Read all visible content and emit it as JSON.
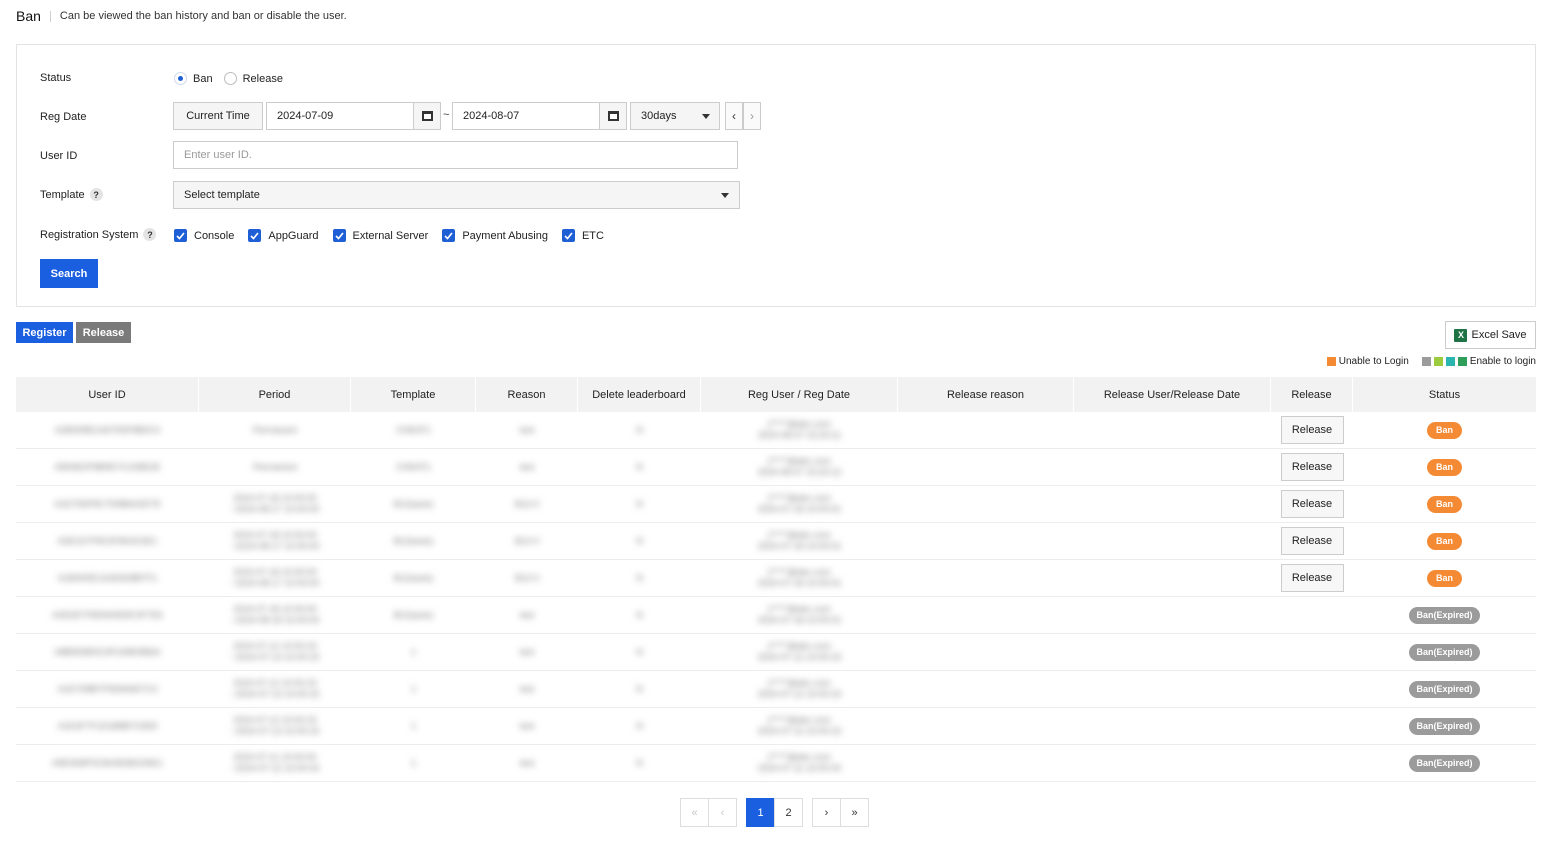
{
  "header": {
    "title": "Ban",
    "description": "Can be viewed the ban history and ban or disable the user."
  },
  "search": {
    "status_label": "Status",
    "status_options": [
      "Ban",
      "Release"
    ],
    "status_selected": "Ban",
    "reg_date_label": "Reg Date",
    "current_time_label": "Current Time",
    "date_from": "2024-07-09",
    "date_to": "2024-08-07",
    "date_separator": "~",
    "range_selected": "30days",
    "user_id_label": "User ID",
    "user_id_placeholder": "Enter user ID.",
    "template_label": "Template",
    "template_placeholder": "Select template",
    "reg_system_label": "Registration System",
    "reg_systems": [
      "Console",
      "AppGuard",
      "External Server",
      "Payment Abusing",
      "ETC"
    ],
    "search_label": "Search",
    "help_glyph": "?"
  },
  "actions": {
    "register_label": "Register",
    "release_label": "Release",
    "excel_label": "Excel Save",
    "excel_glyph": "X"
  },
  "legend": {
    "unable": "Unable to Login",
    "enable": "Enable to login",
    "colors": {
      "unable": "#f58a35",
      "enable": [
        "#9b9b9b",
        "#9ccc3d",
        "#2bb5b0",
        "#2e9e5b"
      ]
    }
  },
  "table": {
    "headers": [
      "User ID",
      "Period",
      "Template",
      "Reason",
      "Delete leaderboard",
      "Reg User / Reg Date",
      "Release reason",
      "Release User/Release Date",
      "Release",
      "Status"
    ],
    "release_button_label": "Release",
    "rows": [
      {
        "user_id": "A2B3D8E1A67D5F8B0C4",
        "period": "Permanent",
        "template": "CHEAT1",
        "reason": "test",
        "delete": "N",
        "reg": "j*****@abc.com\n2024-08-07 15:20:11",
        "has_release": true,
        "status": "Ban"
      },
      {
        "user_id": "A9D6E0F8B9E7C1D8E2E",
        "period": "Permanent",
        "template": "CHEAT1",
        "reason": "test",
        "delete": "N",
        "reg": "j*****@abc.com\n2024-08-07 15:20:12",
        "has_release": true,
        "status": "Ban"
      },
      {
        "user_id": "A1E7D5F8C7D9B6A2E7D",
        "period": "2024-07-18 10:00:00\n~2024-08-17 10:00:00",
        "template": "B12(auto)",
        "reason": "B12-0",
        "delete": "N",
        "reg": "j*****@abc.com\n2024-07-18 10:00:01",
        "has_release": true,
        "status": "Ban"
      },
      {
        "user_id": "A3E1D7F8C5F8A3C6E1",
        "period": "2024-07-18 10:00:00\n~2024-08-17 10:00:00",
        "template": "B12(auto)",
        "reason": "B12-0",
        "delete": "N",
        "reg": "j*****@abc.com\n2024-07-18 10:00:01",
        "has_release": true,
        "status": "Ban"
      },
      {
        "user_id": "A1B4D5E1A2E6D8B7F1",
        "period": "2024-07-18 10:00:00\n~2024-08-17 10:00:00",
        "template": "B12(auto)",
        "reason": "B12-0",
        "delete": "N",
        "reg": "j*****@abc.com\n2024-07-18 10:00:01",
        "has_release": true,
        "status": "Ban"
      },
      {
        "user_id": "A4D2E7F8D9A5E8C3F7E6",
        "period": "2024-07-18 10:00:00\n~2024-08-18 10:00:00",
        "template": "B12(auto)",
        "reason": "test",
        "delete": "N",
        "reg": "j*****@abc.com\n2024-07-18 10:00:01",
        "has_release": false,
        "status": "Ban(Expired)"
      },
      {
        "user_id": "A8B9D8E5C9F2A8D9B6A",
        "period": "2024-07-12 10:00:15\n~2024-07-13 10:00:15",
        "template": "1",
        "reason": "test",
        "delete": "N",
        "reg": "j*****@abc.com\n2024-07-12 10:00:15",
        "has_release": false,
        "status": "Ban(Expired)"
      },
      {
        "user_id": "A1E7D8B7F5E8A6E7C3",
        "period": "2024-07-12 10:00:15\n~2024-07-13 10:00:15",
        "template": "1",
        "reason": "test",
        "delete": "N",
        "reg": "j*****@abc.com\n2024-07-12 10:00:15",
        "has_release": false,
        "status": "Ban(Expired)"
      },
      {
        "user_id": "A1E3F7F1D1B8B7C6E8",
        "period": "2024-07-12 10:00:15\n~2024-07-13 10:00:15",
        "template": "1",
        "reason": "test",
        "delete": "N",
        "reg": "j*****@abc.com\n2024-07-12 10:00:15",
        "has_release": false,
        "status": "Ban(Expired)"
      },
      {
        "user_id": "A9E3D8F5C8A3E6B1D6E1",
        "period": "2024-07-11 10:00:04\n~2024-07-12 10:00:04",
        "template": "1",
        "reason": "test",
        "delete": "N",
        "reg": "j*****@abc.com\n2024-07-11 10:00:04",
        "has_release": false,
        "status": "Ban(Expired)"
      }
    ]
  },
  "pagination": {
    "pages": [
      "1",
      "2"
    ],
    "current": "1",
    "first_glyph": "«",
    "prev_glyph": "‹",
    "next_glyph": "›",
    "last_glyph": "»"
  }
}
